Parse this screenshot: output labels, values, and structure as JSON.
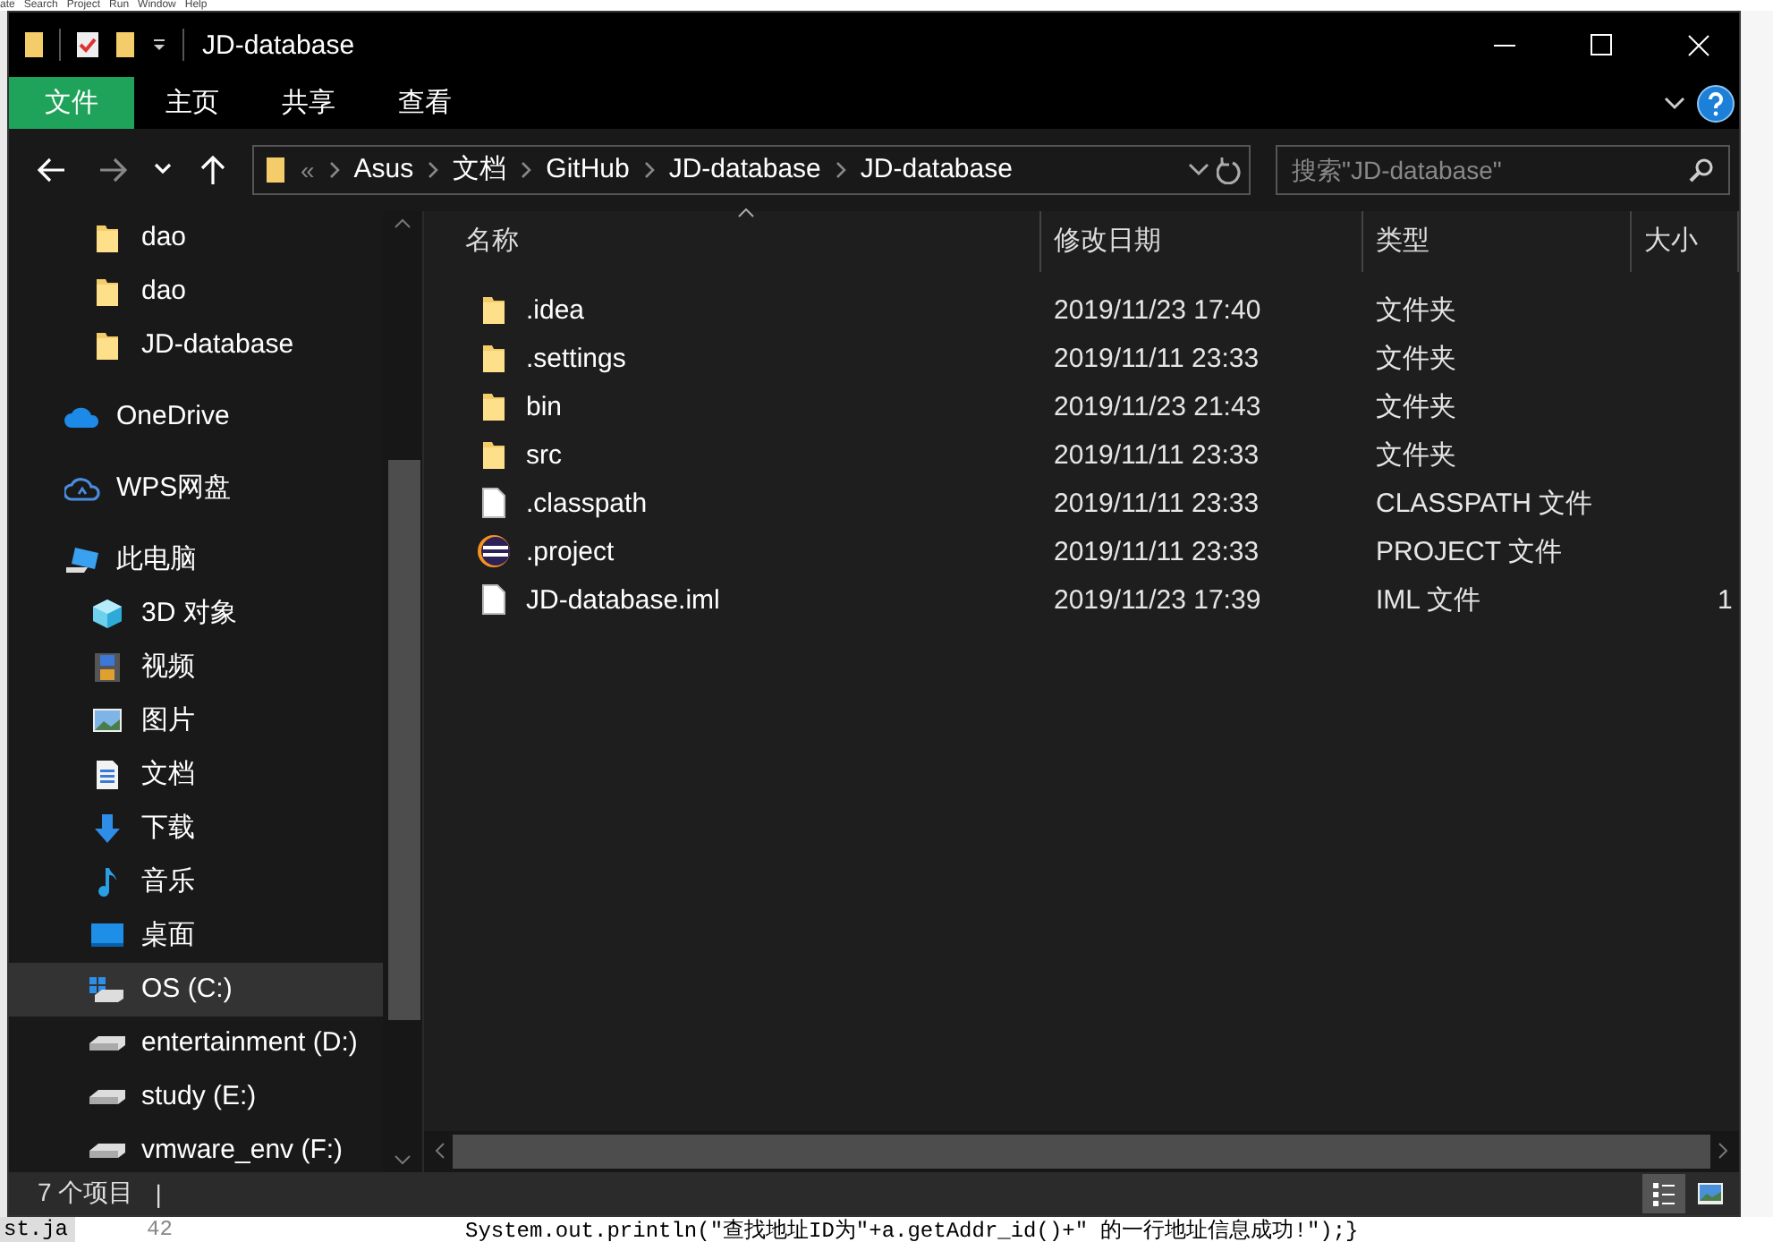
{
  "background_app": {
    "menu": "ate   Search   Project   Run   Window   Help",
    "file_tab": "st.ja",
    "line_number": "42",
    "code_line": "System.out.println(\"查找地址ID为\"+a.getAddr_id()+\" 的一行地址信息成功!\");}"
  },
  "window": {
    "title": "JD-database"
  },
  "ribbon": {
    "tabs": [
      {
        "label": "文件",
        "selected": true
      },
      {
        "label": "主页",
        "selected": false
      },
      {
        "label": "共享",
        "selected": false
      },
      {
        "label": "查看",
        "selected": false
      }
    ]
  },
  "address_bar": {
    "overflow": "«",
    "path": [
      "Asus",
      "文档",
      "GitHub",
      "JD-database",
      "JD-database"
    ]
  },
  "search": {
    "placeholder": "搜索\"JD-database\""
  },
  "sidebar": {
    "quick_access_children": [
      {
        "label": "dao",
        "kind": "folder",
        "selected": false
      },
      {
        "label": "dao",
        "kind": "folder",
        "selected": false
      },
      {
        "label": "JD-database",
        "kind": "folder",
        "selected": false
      }
    ],
    "items": [
      {
        "label": "OneDrive",
        "kind": "onedrive",
        "selected": false
      },
      {
        "label": "WPS网盘",
        "kind": "cloud",
        "selected": false
      },
      {
        "label": "此电脑",
        "kind": "pc",
        "selected": false,
        "children": [
          {
            "label": "3D 对象",
            "kind": "cube",
            "selected": false
          },
          {
            "label": "视频",
            "kind": "video",
            "selected": false
          },
          {
            "label": "图片",
            "kind": "picture",
            "selected": false
          },
          {
            "label": "文档",
            "kind": "document",
            "selected": false
          },
          {
            "label": "下载",
            "kind": "download",
            "selected": false
          },
          {
            "label": "音乐",
            "kind": "music",
            "selected": false
          },
          {
            "label": "桌面",
            "kind": "desktop",
            "selected": false
          },
          {
            "label": "OS (C:)",
            "kind": "system-drive",
            "selected": true
          },
          {
            "label": "entertainment (D:)",
            "kind": "drive",
            "selected": false
          },
          {
            "label": "study (E:)",
            "kind": "drive",
            "selected": false
          },
          {
            "label": "vmware_env (F:)",
            "kind": "drive",
            "selected": false
          }
        ]
      }
    ]
  },
  "table": {
    "columns": [
      "名称",
      "修改日期",
      "类型",
      "大小"
    ],
    "rows": [
      {
        "name": ".idea",
        "kind": "folder",
        "modified": "2019/11/23 17:40",
        "type": "文件夹"
      },
      {
        "name": ".settings",
        "kind": "folder",
        "modified": "2019/11/11 23:33",
        "type": "文件夹"
      },
      {
        "name": "bin",
        "kind": "folder",
        "modified": "2019/11/23 21:43",
        "type": "文件夹"
      },
      {
        "name": "src",
        "kind": "folder",
        "modified": "2019/11/11 23:33",
        "type": "文件夹"
      },
      {
        "name": ".classpath",
        "kind": "file",
        "modified": "2019/11/11 23:33",
        "type": "CLASSPATH 文件"
      },
      {
        "name": ".project",
        "kind": "eclipse",
        "modified": "2019/11/11 23:33",
        "type": "PROJECT 文件"
      },
      {
        "name": "JD-database.iml",
        "kind": "file",
        "modified": "2019/11/23 17:39",
        "type": "IML 文件",
        "size": "1"
      }
    ]
  },
  "status_bar": {
    "count": "7 个项目",
    "separator": "|"
  }
}
